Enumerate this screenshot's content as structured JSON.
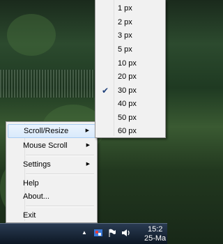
{
  "context_menu": {
    "items": [
      {
        "label": "Scroll/Resize",
        "has_submenu": true,
        "highlighted": true
      },
      {
        "label": "Mouse Scroll",
        "has_submenu": true
      },
      {
        "label": "Settings",
        "has_submenu": true
      },
      {
        "label": "Help",
        "has_submenu": false
      },
      {
        "label": "About...",
        "has_submenu": false
      },
      {
        "label": "Exit",
        "has_submenu": false
      }
    ],
    "arrow_glyph": "▶"
  },
  "submenu": {
    "items": [
      "1 px",
      "2 px",
      "3 px",
      "5 px",
      "10 px",
      "20 px",
      "30 px",
      "40 px",
      "50 px",
      "60 px"
    ],
    "checked": "30 px",
    "check_glyph": "✔"
  },
  "taskbar": {
    "clock_time": "15:2",
    "clock_date": "25-Ma",
    "tray_icons": [
      "show-hidden-icons-arrow-icon",
      "app-tray-icon",
      "flag-icon",
      "volume-icon"
    ]
  },
  "colors": {
    "menu_bg": "#f1f1f1",
    "highlight_bg": "#d9eafc",
    "taskbar_bg": "#0d1724"
  }
}
